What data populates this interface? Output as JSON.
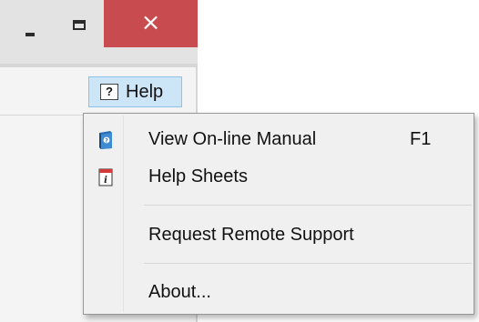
{
  "window": {
    "minimize_glyph": "minimize-icon",
    "maximize_glyph": "maximize-icon",
    "close_glyph": "×",
    "close_color": "#c74b4f"
  },
  "toolbar": {
    "help_icon_glyph": "?",
    "help_label": "Help",
    "help_active_color": "#cde6f7"
  },
  "menu": {
    "items": [
      {
        "label": "View On-line Manual",
        "shortcut": "F1",
        "icon": "manual-book-icon"
      },
      {
        "label": "Help Sheets",
        "icon": "help-sheet-icon"
      },
      {
        "label": "Request Remote Support"
      },
      {
        "label": "About..."
      }
    ]
  }
}
